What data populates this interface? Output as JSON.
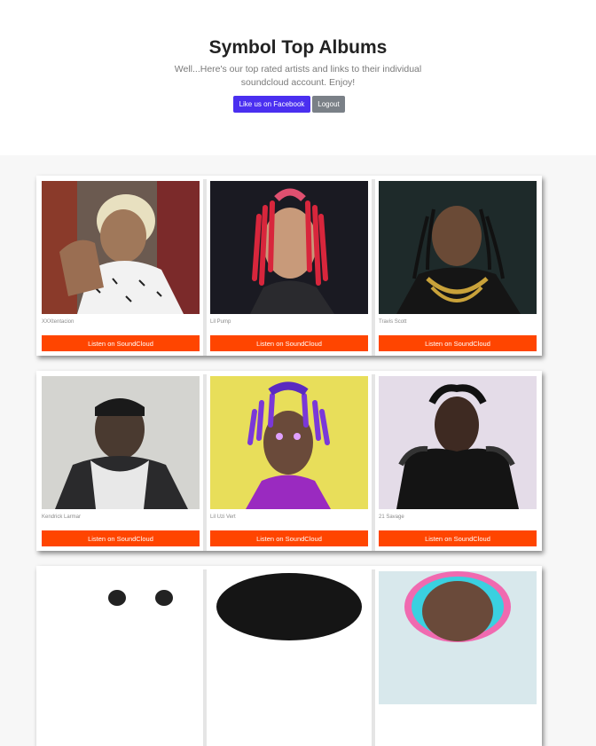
{
  "header": {
    "title": "Symbol Top Albums",
    "lead": "Well...Here's our top rated artists and links to their individual soundcloud account. Enjoy!",
    "facebook_label": "Like us on Facebook",
    "logout_label": "Logout"
  },
  "artists": [
    {
      "name": "XXXtentacion",
      "button": "Listen on SoundCloud"
    },
    {
      "name": "Lil Pump",
      "button": "Listen on SoundCloud"
    },
    {
      "name": "Travis Scott",
      "button": "Listen on SoundCloud"
    },
    {
      "name": "Kendrick Larmar",
      "button": "Listen on SoundCloud"
    },
    {
      "name": "Lil Uzi Vert",
      "button": "Listen on SoundCloud"
    },
    {
      "name": "21 Savage",
      "button": "Listen on SoundCloud"
    },
    {
      "name": "",
      "button": ""
    },
    {
      "name": "",
      "button": ""
    },
    {
      "name": "",
      "button": ""
    }
  ],
  "colors": {
    "facebook_button": "#4a2ff0",
    "logout_button": "#7a8087",
    "soundcloud_button": "#ff4500",
    "page_background": "#f7f7f7"
  }
}
